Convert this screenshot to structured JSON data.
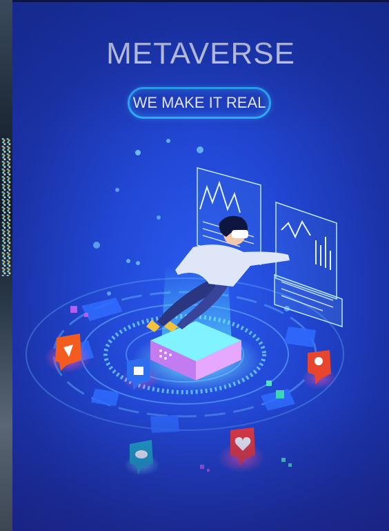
{
  "poster": {
    "title": "METAVERSE",
    "tagline": "WE MAKE IT REAL"
  },
  "colors": {
    "background": "#2248d6",
    "pill_border": "#2fb6ff",
    "text": "#ffffff",
    "hologram_cyan": "#59e6ff",
    "platform_pink": "#d88cff"
  },
  "icons": [
    "play-bubble-icon",
    "like-bubble-icon",
    "chat-bubble-icon",
    "heart-bubble-icon",
    "location-pin-bubble-icon"
  ]
}
